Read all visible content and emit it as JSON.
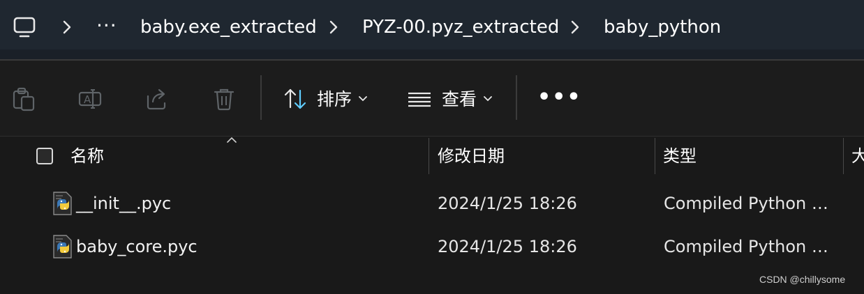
{
  "breadcrumb": {
    "root_icon": "this-pc-icon",
    "overflow": "···",
    "items": [
      "baby.exe_extracted",
      "PYZ-00.pyz_extracted",
      "baby_python"
    ]
  },
  "toolbar": {
    "copy_icon": "clipboard-icon",
    "rename_icon": "rename-icon",
    "share_icon": "share-icon",
    "delete_icon": "trash-icon",
    "sort_label": "排序",
    "view_label": "查看",
    "more_label": "•••"
  },
  "columns": {
    "name": "名称",
    "modified": "修改日期",
    "type": "类型",
    "size": "大"
  },
  "files": [
    {
      "name": "__init__.pyc",
      "modified": "2024/1/25 18:26",
      "type": "Compiled Python Fi...",
      "icon": "python-file-icon"
    },
    {
      "name": "baby_core.pyc",
      "modified": "2024/1/25 18:26",
      "type": "Compiled Python Fi...",
      "icon": "python-file-icon"
    }
  ],
  "watermark": "CSDN @chillysome",
  "colors": {
    "addr_bg": "#1f2730",
    "bg": "#191919",
    "accent": "#60cdff"
  }
}
